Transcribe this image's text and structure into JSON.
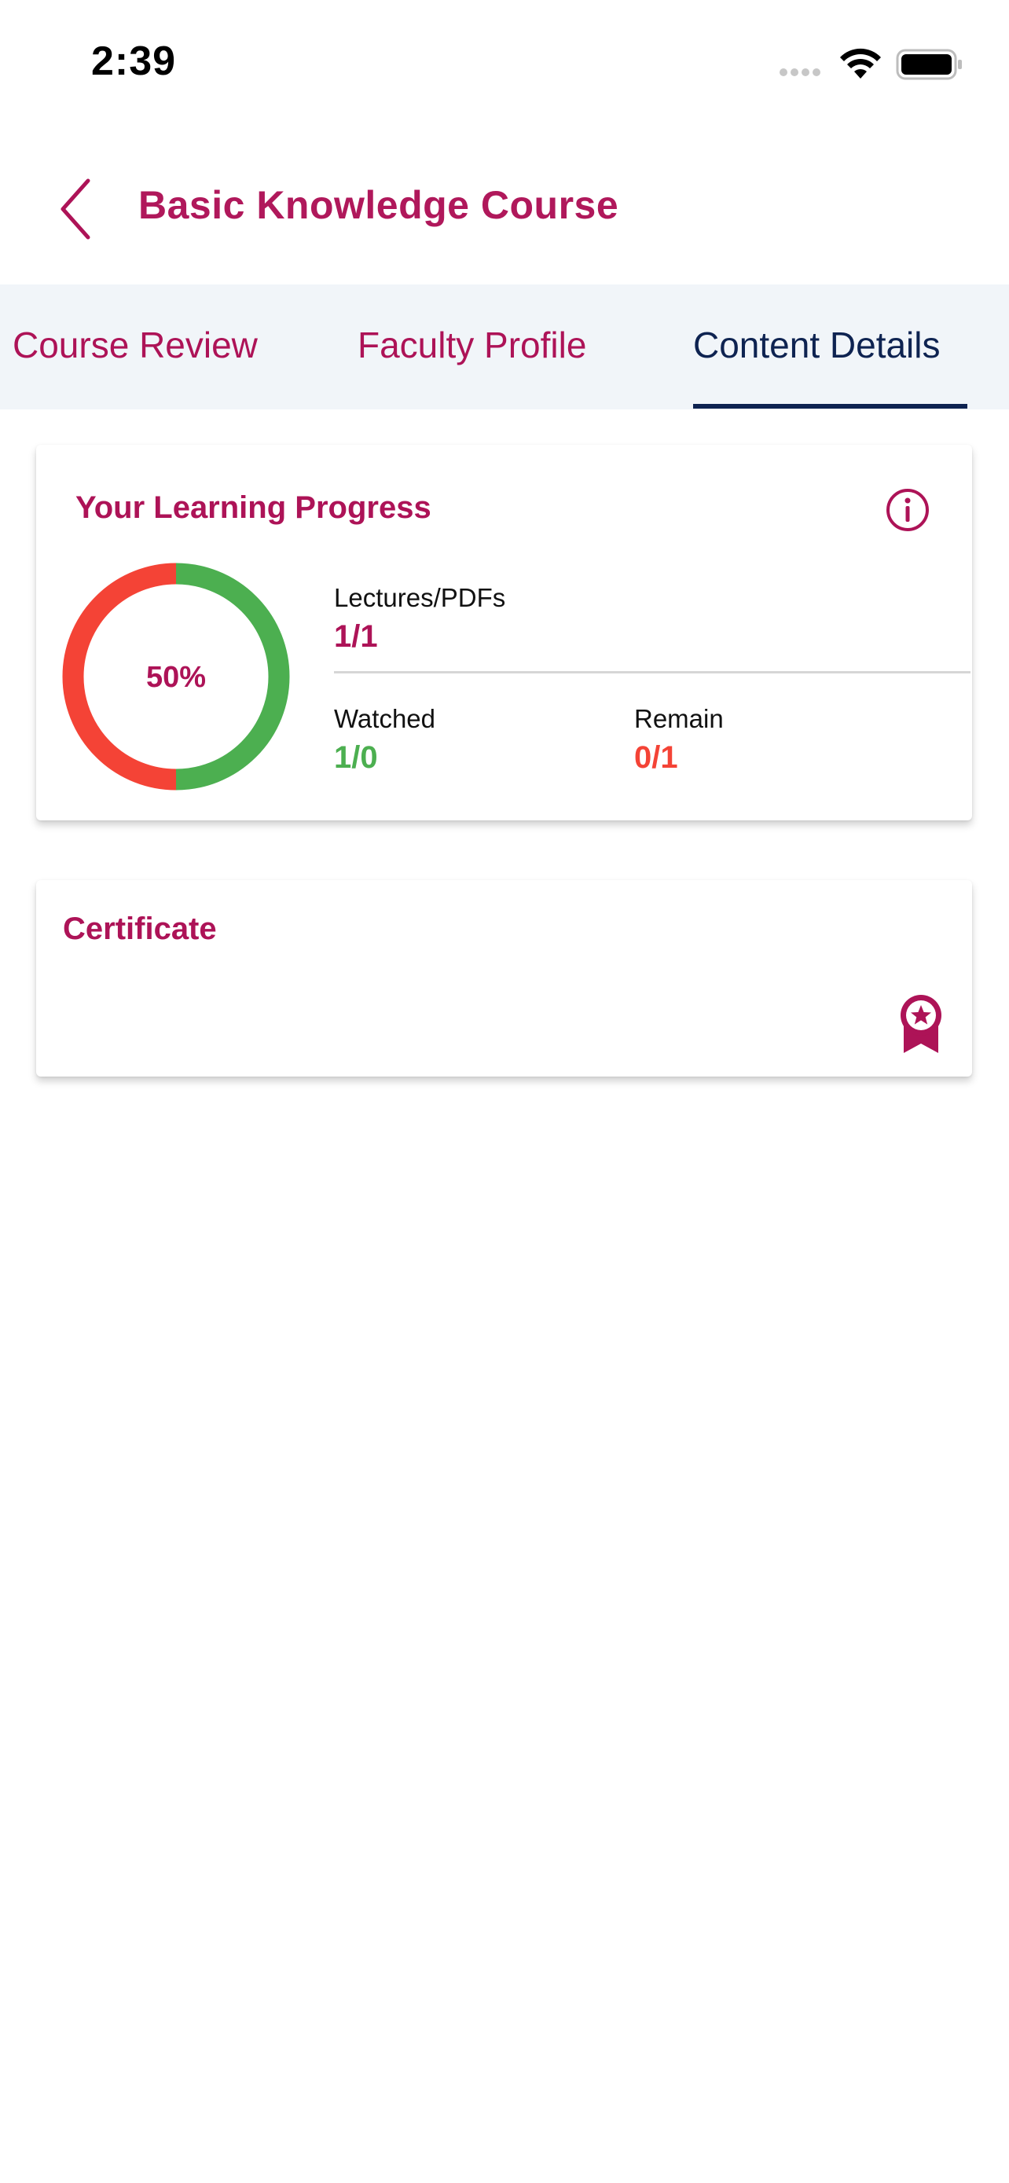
{
  "status_bar": {
    "time": "2:39"
  },
  "header": {
    "title": "Basic Knowledge Course"
  },
  "tabs": [
    {
      "label": "Course Review",
      "active": false
    },
    {
      "label": "Faculty Profile",
      "active": false
    },
    {
      "label": "Content Details",
      "active": true
    }
  ],
  "progress": {
    "title": "Your Learning Progress",
    "percent_label": "50%",
    "percent_complete": 0.5,
    "lectures_label": "Lectures/PDFs",
    "lectures_value": "1/1",
    "watched_label": "Watched",
    "watched_value": "1/0",
    "remain_label": "Remain",
    "remain_value": "0/1"
  },
  "certificate": {
    "title": "Certificate"
  },
  "colors": {
    "brand": "#ad1357",
    "tab_active": "#0e2351",
    "watched": "#4caf50",
    "remain": "#f44336"
  },
  "icons": {
    "back": "chevron-left-icon",
    "info": "info-icon",
    "certificate": "award-ribbon-icon"
  }
}
